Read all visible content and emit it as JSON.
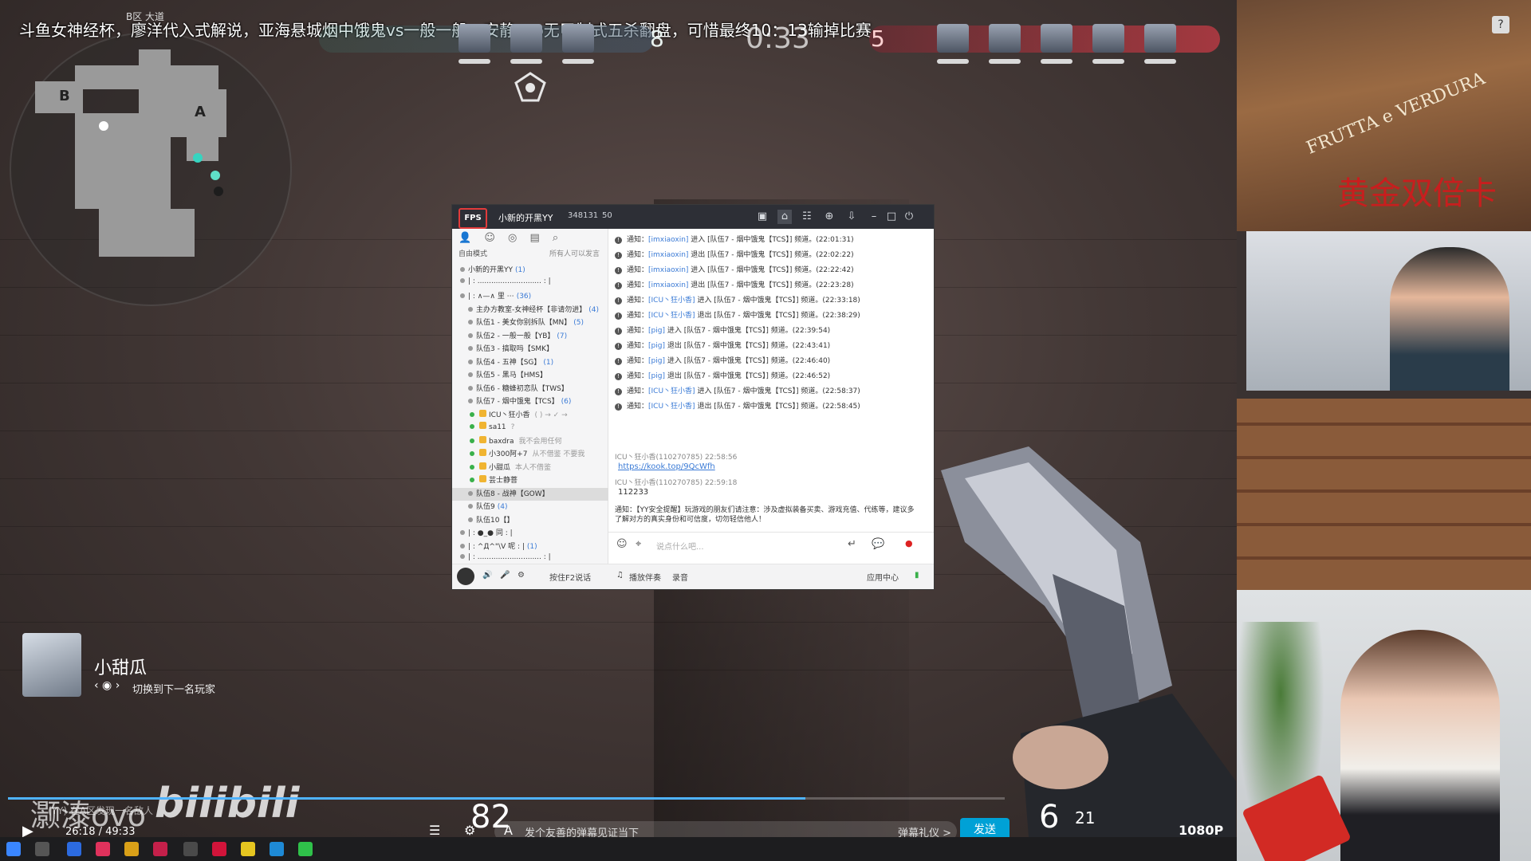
{
  "stream_banner": {
    "title": "斗鱼女神经杯，廖洋代入式解说，亚海悬城烟中饿鬼vs一般一般，安静eco无甲制式五杀翻盘，可惜最终10：13输掉比赛",
    "small": "B区 大道"
  },
  "hud": {
    "score_left": "8",
    "timer": "0:33",
    "score_right": "5"
  },
  "minimap": {
    "label_b": "B",
    "label_a": "A"
  },
  "yy": {
    "logo": "FPS",
    "channel": "小新的开黑YY",
    "channel_id": "348131",
    "online": "50",
    "left_tools": "👤 ☺ ◎ ▤ ⌕",
    "mode": "自由模式",
    "mode_right": "所有人可以发言",
    "tree": [
      {
        "text": "小新的开黑YY",
        "count": "(1)"
      },
      {
        "text": "| :  ............................  : |",
        "count": ""
      },
      {
        "text": "| :       ∧—∧     里         ⋯",
        "count": "(36)"
      },
      {
        "text": "主办方教室-女神经杯【非请勿进】",
        "count": "(4)"
      },
      {
        "text": "队伍1 - 美女你别拆队【MN】",
        "count": "(5)"
      },
      {
        "text": "队伍2 - 一般一般【YB】",
        "count": "(7)"
      },
      {
        "text": "队伍3 - 搞取吗【SMK】",
        "count": ""
      },
      {
        "text": "队伍4 - 五神【SG】",
        "count": "(1)"
      },
      {
        "text": "队伍5 - 黑马【HMS】",
        "count": ""
      },
      {
        "text": "队伍6 - 糖蜂初恋队【TWS】",
        "count": ""
      },
      {
        "text": "队伍7 - 烟中饿鬼【TCS】",
        "count": "(6)"
      },
      {
        "text": "ICU丶狂小香",
        "count": "",
        "note": "( ) → ✓ →",
        "member": true
      },
      {
        "text": "sa11",
        "count": "",
        "note": "?",
        "member": true
      },
      {
        "text": "baxdra",
        "count": "",
        "note": "我不会用任何",
        "member": true
      },
      {
        "text": "小300阿+7",
        "count": "",
        "note": "从不借鉴 不要我",
        "member": true
      },
      {
        "text": "小甜瓜",
        "count": "",
        "note": "本人不借鉴",
        "member": true
      },
      {
        "text": "芸士静菩",
        "count": "",
        "note": "",
        "member": true
      },
      {
        "text": "队伍8 - 战神【GOW】",
        "count": "",
        "selected": true
      },
      {
        "text": "队伍9",
        "count": "(4)"
      },
      {
        "text": "队伍10【】",
        "count": ""
      },
      {
        "text": "| :       ●_●      同          : |",
        "count": ""
      },
      {
        "text": "| :       ^Д^\"\\V    呢         : |",
        "count": "(1)"
      },
      {
        "text": "| :  ............................  : |",
        "count": ""
      }
    ],
    "messages": [
      {
        "pre": "通知：",
        "user": "[imxiaoxin]",
        "post": " 进入 [队伍7 - 烟中饿鬼【TCS】] 频道。(22:01:31)"
      },
      {
        "pre": "通知：",
        "user": "[imxiaoxin]",
        "post": " 退出 [队伍7 - 烟中饿鬼【TCS】] 频道。(22:02:22)"
      },
      {
        "pre": "通知：",
        "user": "[imxiaoxin]",
        "post": " 进入 [队伍7 - 烟中饿鬼【TCS】] 频道。(22:22:42)"
      },
      {
        "pre": "通知：",
        "user": "[imxiaoxin]",
        "post": " 退出 [队伍7 - 烟中饿鬼【TCS】] 频道。(22:23:28)"
      },
      {
        "pre": "通知：",
        "user": "[ICU丶狂小香]",
        "post": " 进入 [队伍7 - 烟中饿鬼【TCS】] 频道。(22:33:18)"
      },
      {
        "pre": "通知：",
        "user": "[ICU丶狂小香]",
        "post": " 退出 [队伍7 - 烟中饿鬼【TCS】] 频道。(22:38:29)"
      },
      {
        "pre": "通知：",
        "user": "[pig]",
        "post": " 进入 [队伍7 - 烟中饿鬼【TCS】] 频道。(22:39:54)"
      },
      {
        "pre": "通知：",
        "user": "[pig]",
        "post": " 退出 [队伍7 - 烟中饿鬼【TCS】] 频道。(22:43:41)"
      },
      {
        "pre": "通知：",
        "user": "[pig]",
        "post": " 进入 [队伍7 - 烟中饿鬼【TCS】] 频道。(22:46:40)"
      },
      {
        "pre": "通知：",
        "user": "[pig]",
        "post": " 退出 [队伍7 - 烟中饿鬼【TCS】] 频道。(22:46:52)"
      },
      {
        "pre": "通知：",
        "user": "[ICU丶狂小香]",
        "post": " 进入 [队伍7 - 烟中饿鬼【TCS】] 频道。(22:58:37)"
      },
      {
        "pre": "通知：",
        "user": "[ICU丶狂小香]",
        "post": " 退出 [队伍7 - 烟中饿鬼【TCS】] 频道。(22:58:45)"
      }
    ],
    "chat1_head": "ICU丶狂小香(110270785)  22:58:56",
    "chat1_link": "https://kook.top/9QcWfh",
    "chat2_head": "ICU丶狂小香(110270785)  22:59:18",
    "chat2_body": "112233",
    "warning": "通知：【YY安全提醒】玩游戏的朋友们请注意：涉及虚拟装备买卖、游戏充值、代练等，建议多了解对方的真实身份和可信度，切勿轻信他人！",
    "input_placeholder": "说点什么吧...",
    "bottom_f2": "按住F2说话",
    "bottom_music": "播放伴奏",
    "bottom_record": "录音",
    "bottom_apps": "应用中心"
  },
  "spectate": {
    "name": "小甜瓜",
    "hint": "切换到下一名玩家"
  },
  "player": {
    "health": "82",
    "ammo": "6",
    "reserve": "21",
    "time": "26:18 / 49:33",
    "quality": "1080P 60",
    "watermark_ovo": "灏溙ovo",
    "watermark_bili": "bilibili",
    "watermark_sub": "(YY)  在A区发现一名敌人",
    "danmu_placeholder": "发个友善的弹幕见证当下",
    "danmu_etiquette": "弹幕礼仪 >",
    "send": "发送"
  },
  "cam": {
    "sign": "FRUTTA e VERDURA",
    "double_card": "黄金双倍卡",
    "help": "?"
  },
  "colors": {
    "bilibili_blue": "#00a1d6",
    "team_left": "#3aa08c",
    "team_right": "#c83c46",
    "yy_title": "#2d2f36"
  }
}
